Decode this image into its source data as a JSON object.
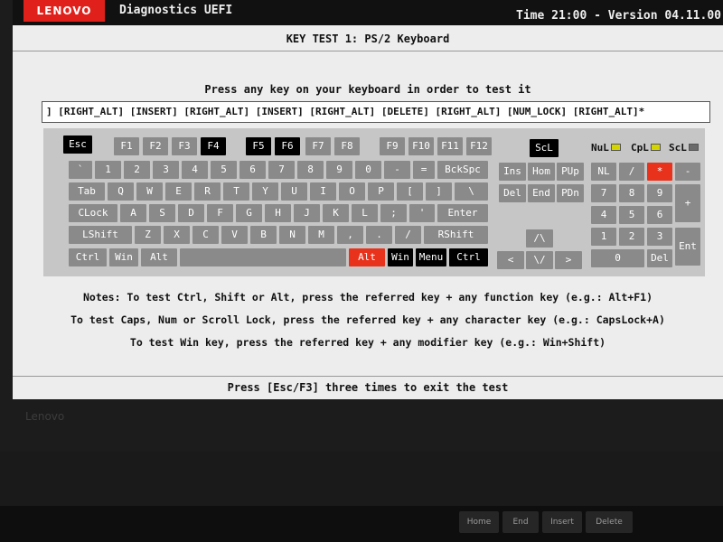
{
  "header": {
    "brand": "LENOVO",
    "title": "Diagnostics UEFI",
    "time_version": "Time 21:00 - Version 04.11.00"
  },
  "test_title": "KEY TEST 1: PS/2 Keyboard",
  "instruction": "Press any key on your keyboard in order to test it",
  "key_log": "] [RIGHT_ALT] [INSERT] [RIGHT_ALT] [INSERT] [RIGHT_ALT] [DELETE] [RIGHT_ALT] [NUM_LOCK] [RIGHT_ALT]*",
  "keyboard": {
    "fn_row": [
      "Esc",
      "F1",
      "F2",
      "F3",
      "F4",
      "F5",
      "F6",
      "F7",
      "F8",
      "F9",
      "F10",
      "F11",
      "F12",
      "ScL"
    ],
    "number_row": [
      "`",
      "1",
      "2",
      "3",
      "4",
      "5",
      "6",
      "7",
      "8",
      "9",
      "0",
      "-",
      "=",
      "BckSpc"
    ],
    "qwerty_row": [
      "Tab",
      "Q",
      "W",
      "E",
      "R",
      "T",
      "Y",
      "U",
      "I",
      "O",
      "P",
      "[",
      "]",
      "\\"
    ],
    "home_row": [
      "CLock",
      "A",
      "S",
      "D",
      "F",
      "G",
      "H",
      "J",
      "K",
      "L",
      ";",
      "'",
      "Enter"
    ],
    "shift_row": [
      "LShift",
      "Z",
      "X",
      "C",
      "V",
      "B",
      "N",
      "M",
      ",",
      ".",
      "/",
      "RShift"
    ],
    "bottom_row": [
      "Ctrl",
      "Win",
      "Alt",
      "Alt",
      "Win",
      "Menu",
      "Ctrl"
    ],
    "nav_keys": [
      "Ins",
      "Hom",
      "PUp",
      "Del",
      "End",
      "PDn"
    ],
    "arrow_keys": [
      "/\\",
      "<",
      "\\/",
      ">"
    ],
    "numpad": [
      "NL",
      "/",
      "*",
      "-",
      "7",
      "8",
      "9",
      "+",
      "4",
      "5",
      "6",
      "1",
      "2",
      "3",
      "Ent",
      "0",
      "Del"
    ],
    "locks": [
      "NuL",
      "CpL",
      "ScL"
    ]
  },
  "colors": {
    "pressed_key": "#000000",
    "alert_key": "#e8321c",
    "idle_key": "#8a8a8a",
    "num_lock_lamp": "#d4d400",
    "caps_lock_lamp": "#d4d400",
    "scroll_lock_lamp": "#6a6a6a"
  },
  "notes": [
    "Notes: To test Ctrl, Shift or Alt, press the referred key + any function key (e.g.: Alt+F1)",
    "To test Caps, Num or Scroll Lock, press the referred key + any character key (e.g.: CapsLock+A)",
    "To test Win key, press the referred key + any modifier key (e.g.: Win+Shift)"
  ],
  "footer": "Press [Esc/F3] three times to exit the test",
  "bezel_logo": "Lenovo",
  "physical_keys": [
    "Home",
    "End",
    "Insert",
    "Delete"
  ]
}
